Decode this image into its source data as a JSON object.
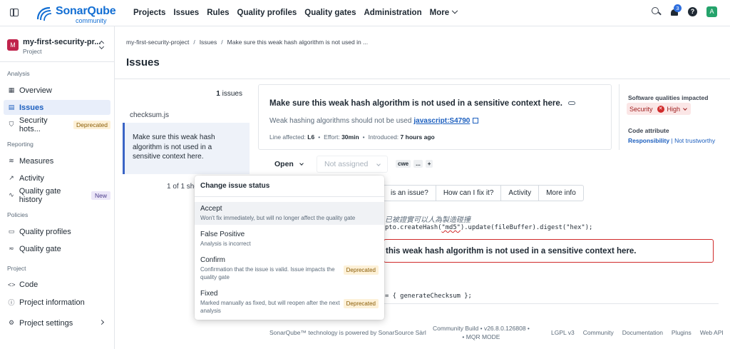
{
  "app": {
    "brand": "SonarQube",
    "brand_sub": "community",
    "brand_color": "#126ed3"
  },
  "topnav": {
    "items": [
      "Projects",
      "Issues",
      "Rules",
      "Quality profiles",
      "Quality gates",
      "Administration",
      "More"
    ],
    "notification_count": "3",
    "help_label": "?",
    "avatar_letter": "A"
  },
  "sidebar": {
    "project_initial": "M",
    "project_name": "my-first-security-pr...",
    "project_type": "Project",
    "sections": {
      "analysis": "Analysis",
      "reporting": "Reporting",
      "policies": "Policies",
      "project": "Project"
    },
    "items": {
      "overview": "Overview",
      "issues": "Issues",
      "security_hotspots": "Security hots...",
      "security_hotspots_tag": "Deprecated",
      "measures": "Measures",
      "activity": "Activity",
      "quality_gate_history": "Quality gate history",
      "quality_gate_history_tag": "New",
      "quality_profiles": "Quality profiles",
      "quality_gate": "Quality gate",
      "code": "Code",
      "project_information": "Project information",
      "project_settings": "Project settings"
    }
  },
  "breadcrumb": {
    "project": "my-first-security-project",
    "issues": "Issues",
    "current": "Make sure this weak hash algorithm is not used in ..."
  },
  "page_title": "Issues",
  "issue_list": {
    "count": "1",
    "count_label": "issues",
    "file": "checksum.js",
    "card_text": "Make sure this weak hash algorithm is not used in a sensitive context here.",
    "paging": "1 of 1 sho"
  },
  "issue": {
    "title": "Make sure this weak hash algorithm is not used in a sensitive context here.",
    "desc_prefix": "Weak hashing algorithms should not be used",
    "rule": "javascript:S4790",
    "line_label": "Line affected:",
    "line_value": "L6",
    "effort_label": "Effort:",
    "effort_value": "30min",
    "introduced_label": "Introduced:",
    "introduced_value": "7 hours ago",
    "status": "Open",
    "assignee_placeholder": "Not assigned",
    "tags": [
      "cwe",
      "...",
      "+"
    ]
  },
  "qualities": {
    "impacted_label": "Software qualities impacted",
    "quality": "Security",
    "severity": "High",
    "attribute_label": "Code attribute",
    "attribute": "Responsibility",
    "attribute_detail": "Not trustworthy"
  },
  "tabs": [
    "is an issue?",
    "How can I fix it?",
    "Activity",
    "More info"
  ],
  "code": {
    "comment": "已被證實可以人為製造碰撞",
    "line1_prefix": "pto.createHash(",
    "line1_arg": "\"md5\"",
    "line1_suffix": ").update(fileBuffer).digest(\"hex\");",
    "issue_box_text": "this weak hash algorithm is not used in a sensitive context here.",
    "line2": "= { generateChecksum };"
  },
  "dropdown": {
    "header": "Change issue status",
    "items": [
      {
        "title": "Accept",
        "desc": "Won't fix immediately, but will no longer affect the quality gate",
        "tag": ""
      },
      {
        "title": "False Positive",
        "desc": "Analysis is incorrect",
        "tag": ""
      },
      {
        "title": "Confirm",
        "desc": "Confirmation that the issue is valid. Issue impacts the quality gate",
        "tag": "Deprecated"
      },
      {
        "title": "Fixed",
        "desc": "Marked manually as fixed, but will reopen after the next analysis",
        "tag": "Deprecated"
      }
    ]
  },
  "footer": {
    "powered": "SonarQube™ technology is powered by SonarSource Sàrl",
    "build_line1": "Community Build • v26.8.0.126808 •",
    "build_line2": "MQR MODE",
    "links": [
      "LGPL v3",
      "Community",
      "Documentation",
      "Plugins",
      "Web API"
    ]
  },
  "colors": {
    "accent": "#1c5fbf",
    "issue_border": "#d02b2b",
    "deprecated_bg": "#fdf1d8",
    "high_severity": "#d02b2b"
  }
}
